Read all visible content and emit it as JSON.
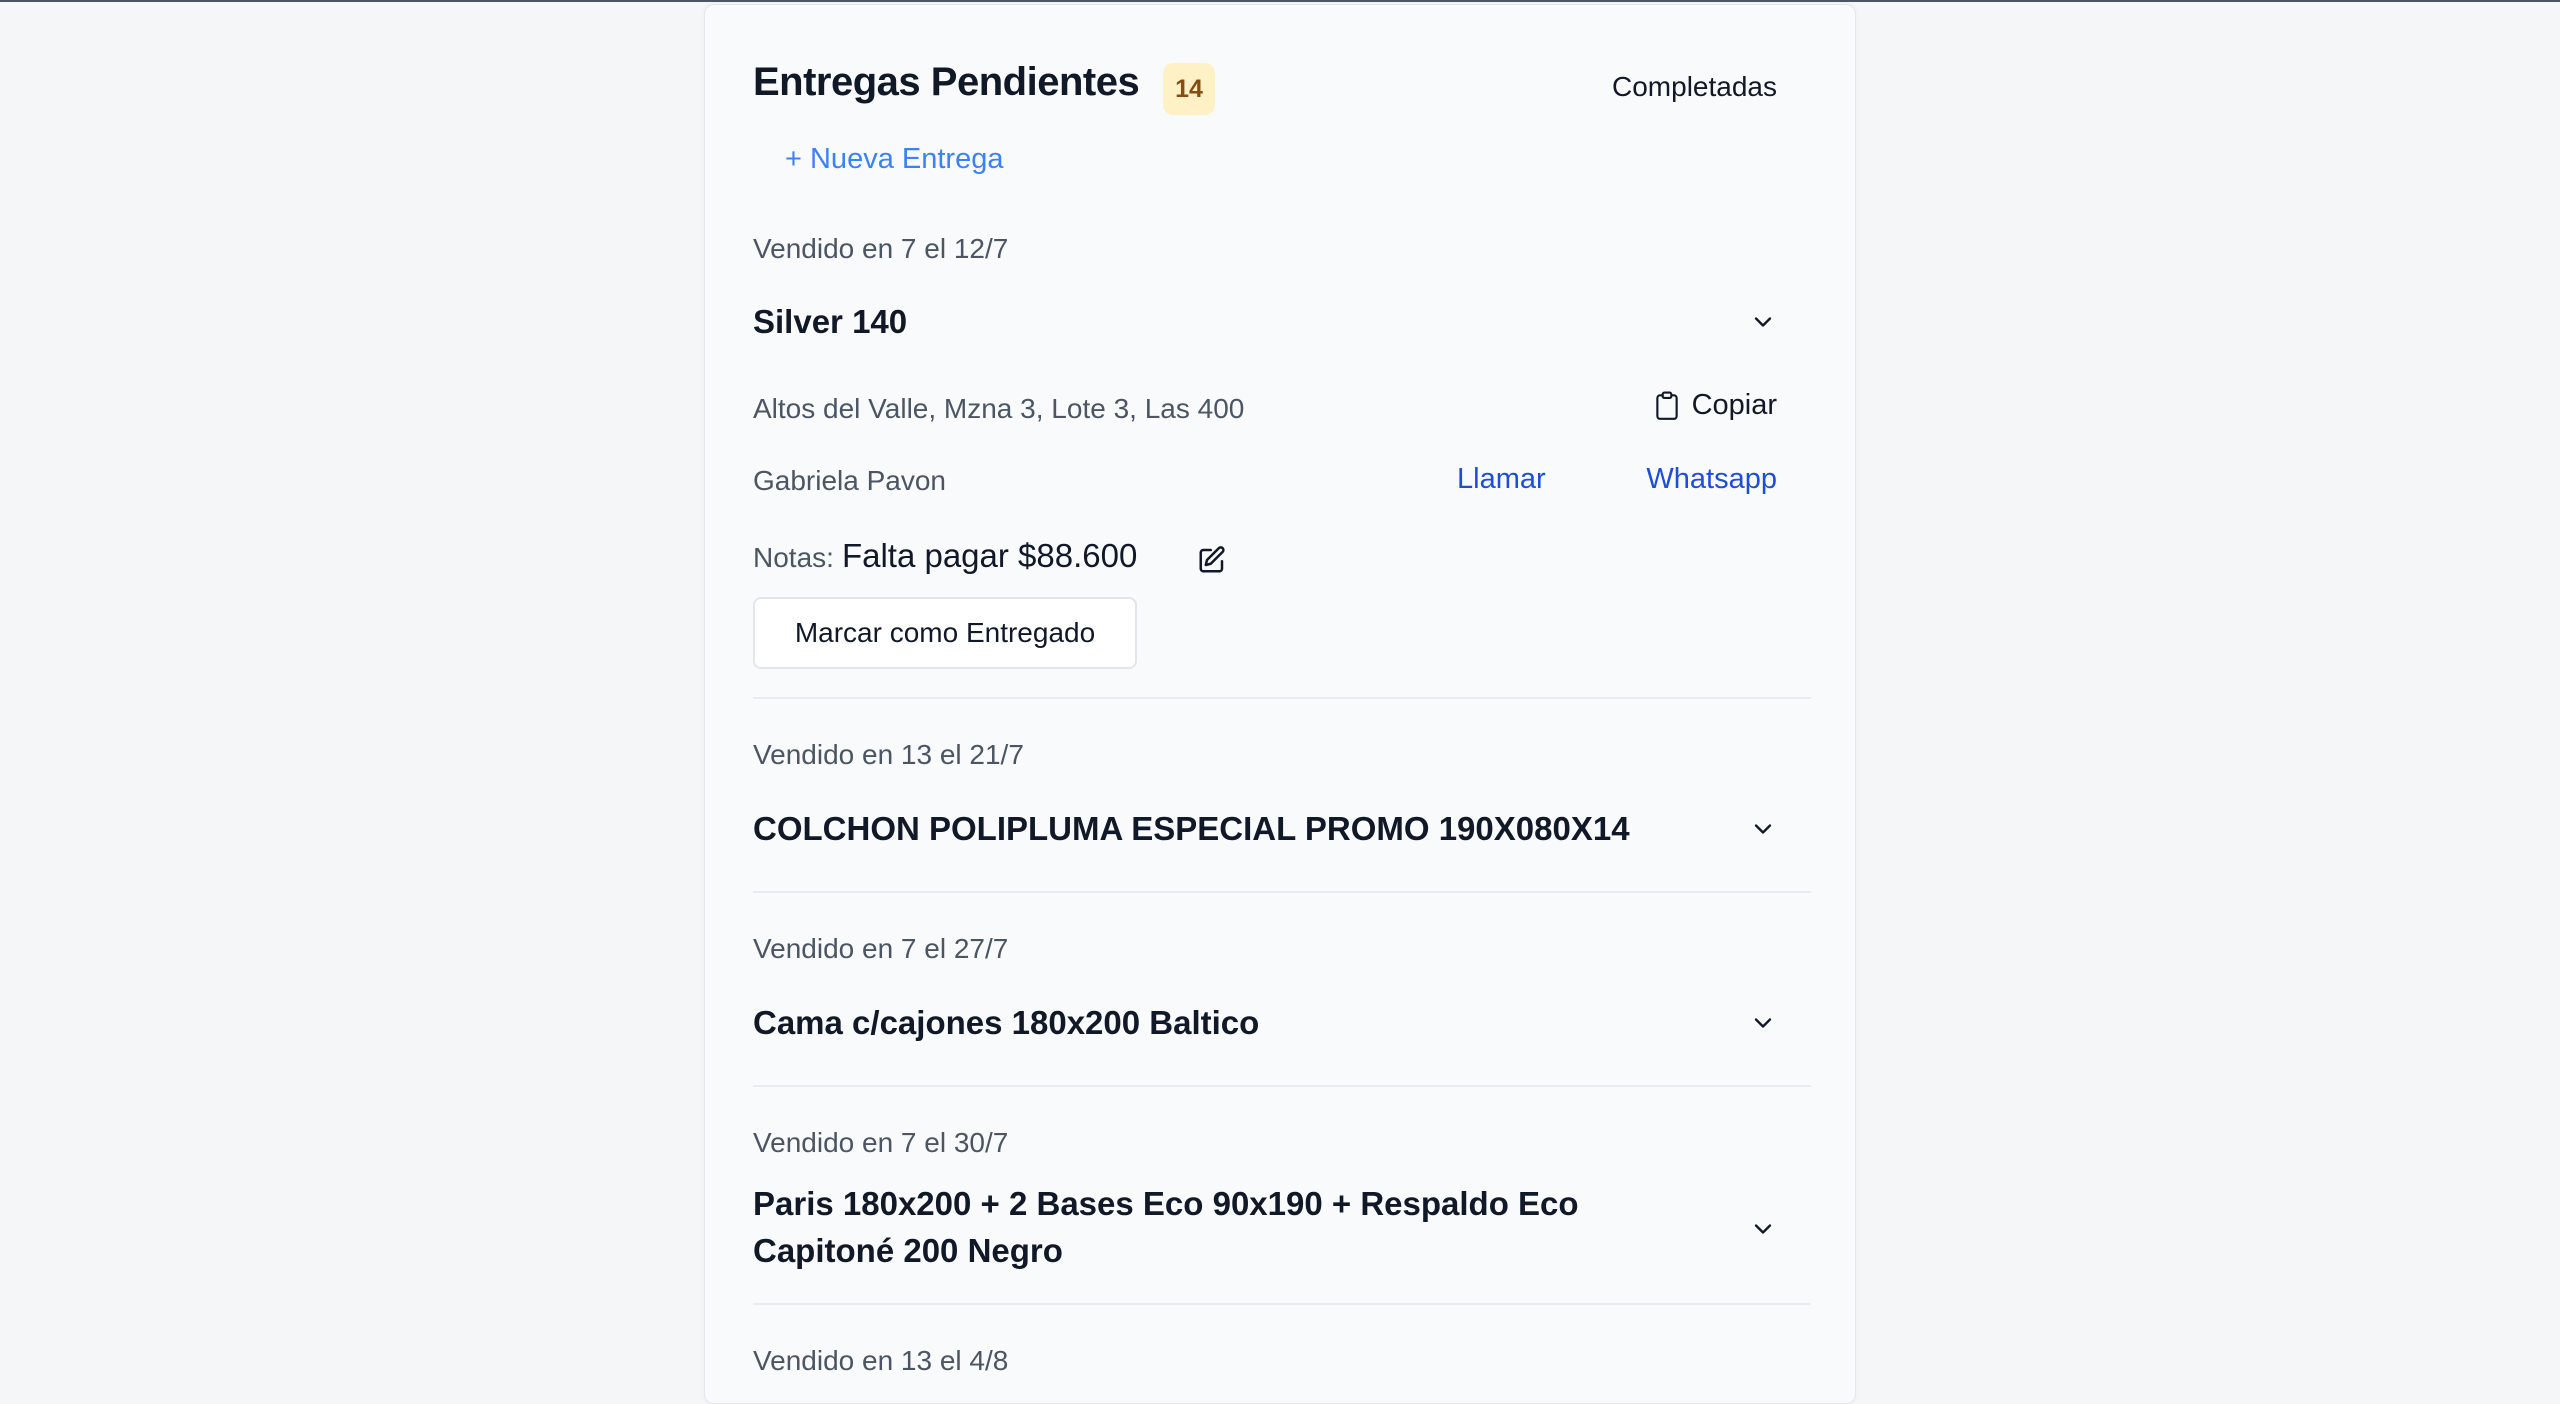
{
  "header": {
    "title": "Entregas Pendientes",
    "pending_count": "14",
    "completed_tab": "Completadas",
    "new_delivery": "+ Nueva Entrega"
  },
  "deliveries": [
    {
      "sold_info": "Vendido en 7 el 12/7",
      "product": "Silver 140",
      "expanded": true,
      "address": "Altos del Valle, Mzna 3, Lote 3, Las 400",
      "copy_label": "Copiar",
      "customer": "Gabriela Pavon",
      "call_label": "Llamar",
      "whatsapp_label": "Whatsapp",
      "notes_label": "Notas:",
      "notes": "Falta pagar $88.600",
      "mark_delivered_label": "Marcar como Entregado"
    },
    {
      "sold_info": "Vendido en 13 el 21/7",
      "product": "COLCHON POLIPLUMA ESPECIAL PROMO 190X080X14",
      "expanded": false
    },
    {
      "sold_info": "Vendido en 7 el 27/7",
      "product": "Cama c/cajones 180x200 Baltico",
      "expanded": false
    },
    {
      "sold_info": "Vendido en 7 el 30/7",
      "product": "Paris 180x200 + 2 Bases Eco 90x190 + Respaldo Eco Capitoné 200 Negro",
      "expanded": false
    },
    {
      "sold_info": "Vendido en 13 el 4/8"
    }
  ],
  "icons": {
    "chevron": "chevron-down-icon",
    "clipboard": "clipboard-icon",
    "edit": "edit-icon"
  },
  "colors": {
    "link_primary": "#3b82f6",
    "link_action": "#1d4ed8",
    "badge_bg": "#fdf1c5",
    "badge_text": "#8a4b0f"
  }
}
